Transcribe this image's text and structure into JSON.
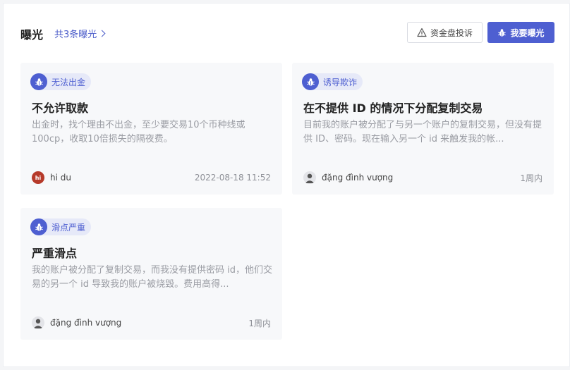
{
  "header": {
    "title": "曝光",
    "count_link": "共3条曝光",
    "complaint_button": "资金盘投诉",
    "expose_button": "我要曝光"
  },
  "cards": [
    {
      "tag": "无法出金",
      "title": "不允许取款",
      "desc": "出金时，找个理由不出金，至少要交易10个币种线或100cp，收取10倍损失的隔夜费。",
      "author": "hi du",
      "avatar_text": "hi",
      "time": "2022-08-18 11:52"
    },
    {
      "tag": "诱导欺诈",
      "title": "在不提供 ID 的情况下分配复制交易",
      "desc": "目前我的账户被分配了与另一个账户的复制交易，但没有提供 ID、密码。现在输入另一个 id 来触发我的帐...",
      "author": "đặng đình vượng",
      "time": "1周内"
    },
    {
      "tag": "滑点严重",
      "title": "严重滑点",
      "desc": "我的账户被分配了复制交易，而我没有提供密码 id，他们交易的另一个 id 导致我的账户被烧毁。费用高得...",
      "author": "đặng đình vượng",
      "time": "1周内"
    }
  ],
  "colors": {
    "accent": "#4e5fd1",
    "tag_bg": "#e6e9f8",
    "card_bg": "#f7f8fa"
  },
  "icons": {
    "tag": "bug-icon",
    "complaint": "warning-icon",
    "expose": "bug-icon"
  }
}
